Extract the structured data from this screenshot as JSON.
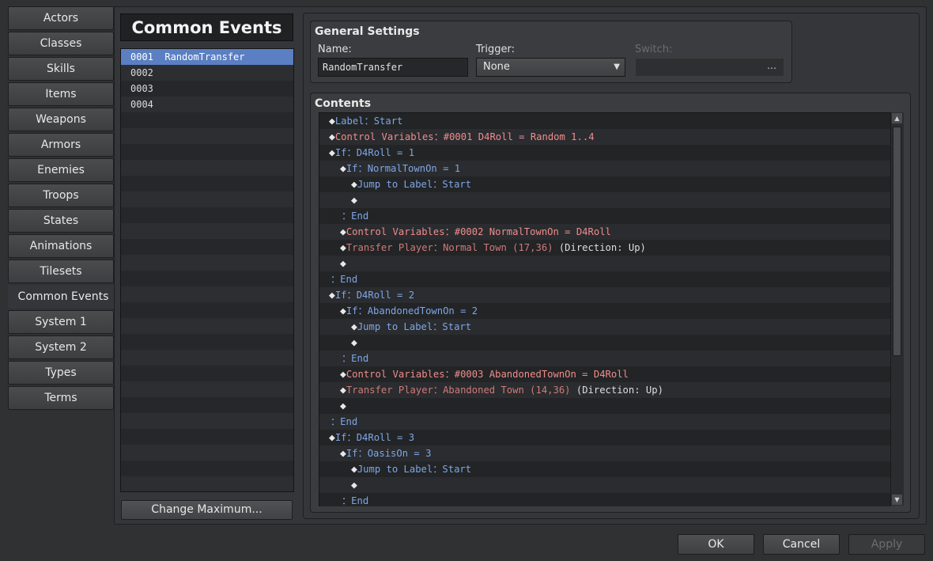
{
  "tabs": [
    "Actors",
    "Classes",
    "Skills",
    "Items",
    "Weapons",
    "Armors",
    "Enemies",
    "Troops",
    "States",
    "Animations",
    "Tilesets",
    "Common Events",
    "System 1",
    "System 2",
    "Types",
    "Terms"
  ],
  "active_tab": "Common Events",
  "events_panel": {
    "title": "Common Events",
    "events": [
      {
        "label": "0001  RandomTransfer",
        "selected": true
      },
      {
        "label": "0002",
        "selected": false
      },
      {
        "label": "0003",
        "selected": false
      },
      {
        "label": "0004",
        "selected": false
      }
    ],
    "change_max_label": "Change Maximum..."
  },
  "general_settings": {
    "title": "General Settings",
    "name_label": "Name:",
    "name_value": "RandomTransfer",
    "trigger_label": "Trigger:",
    "trigger_value": "None",
    "switch_label": "Switch:",
    "switch_button": "…"
  },
  "contents": {
    "title": "Contents",
    "rows": [
      {
        "indent": 0,
        "parts": [
          {
            "c": "blue",
            "t": "Label：Start"
          }
        ]
      },
      {
        "indent": 0,
        "parts": [
          {
            "c": "red",
            "t": "Control Variables：#0001 D4Roll = Random 1..4"
          }
        ]
      },
      {
        "indent": 0,
        "parts": [
          {
            "c": "blue",
            "t": "If：D4Roll = 1"
          }
        ]
      },
      {
        "indent": 1,
        "parts": [
          {
            "c": "blue",
            "t": "If：NormalTownOn = 1"
          }
        ]
      },
      {
        "indent": 2,
        "parts": [
          {
            "c": "blue",
            "t": "Jump to Label：Start"
          }
        ]
      },
      {
        "indent": 2,
        "parts": []
      },
      {
        "indent": 1,
        "end": true,
        "parts": [
          {
            "c": "blue",
            "t": "：End"
          }
        ]
      },
      {
        "indent": 1,
        "parts": [
          {
            "c": "red",
            "t": "Control Variables：#0002 NormalTownOn = D4Roll"
          }
        ]
      },
      {
        "indent": 1,
        "parts": [
          {
            "c": "brown",
            "t": "Transfer Player：Normal Town (17,36)"
          },
          {
            "c": "white",
            "t": " (Direction: Up)"
          }
        ]
      },
      {
        "indent": 1,
        "parts": []
      },
      {
        "indent": 0,
        "end": true,
        "parts": [
          {
            "c": "blue",
            "t": "：End"
          }
        ]
      },
      {
        "indent": 0,
        "parts": [
          {
            "c": "blue",
            "t": "If：D4Roll = 2"
          }
        ]
      },
      {
        "indent": 1,
        "parts": [
          {
            "c": "blue",
            "t": "If：AbandonedTownOn = 2"
          }
        ]
      },
      {
        "indent": 2,
        "parts": [
          {
            "c": "blue",
            "t": "Jump to Label：Start"
          }
        ]
      },
      {
        "indent": 2,
        "parts": []
      },
      {
        "indent": 1,
        "end": true,
        "parts": [
          {
            "c": "blue",
            "t": "：End"
          }
        ]
      },
      {
        "indent": 1,
        "parts": [
          {
            "c": "red",
            "t": "Control Variables：#0003 AbandonedTownOn = D4Roll"
          }
        ]
      },
      {
        "indent": 1,
        "parts": [
          {
            "c": "brown",
            "t": "Transfer Player：Abandoned Town (14,36)"
          },
          {
            "c": "white",
            "t": " (Direction: Up)"
          }
        ]
      },
      {
        "indent": 1,
        "parts": []
      },
      {
        "indent": 0,
        "end": true,
        "parts": [
          {
            "c": "blue",
            "t": "：End"
          }
        ]
      },
      {
        "indent": 0,
        "parts": [
          {
            "c": "blue",
            "t": "If：D4Roll = 3"
          }
        ]
      },
      {
        "indent": 1,
        "parts": [
          {
            "c": "blue",
            "t": "If：OasisOn = 3"
          }
        ]
      },
      {
        "indent": 2,
        "parts": [
          {
            "c": "blue",
            "t": "Jump to Label：Start"
          }
        ]
      },
      {
        "indent": 2,
        "parts": []
      },
      {
        "indent": 1,
        "end": true,
        "parts": [
          {
            "c": "blue",
            "t": "：End"
          }
        ]
      }
    ]
  },
  "buttons": {
    "ok": "OK",
    "cancel": "Cancel",
    "apply": "Apply"
  },
  "colors": {
    "accent": "#5a7fc2",
    "command_blue": "#7fa6e6",
    "command_red": "#f08c8c",
    "transfer_brown": "#cf7a7a"
  }
}
